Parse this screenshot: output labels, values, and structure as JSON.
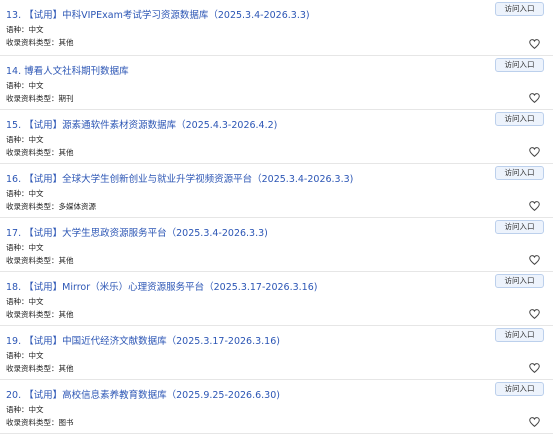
{
  "list": {
    "items": [
      {
        "title": "13. 【试用】中科VIPExam考试学习资源数据库（2025.3.4-2026.3.3)",
        "lang_label": "语种：中文",
        "type_label": "收录资料类型：其他",
        "button": "访问入口"
      },
      {
        "title": "14. 博看人文社科期刊数据库",
        "lang_label": "语种：中文",
        "type_label": "收录资料类型：期刊",
        "button": "访问入口"
      },
      {
        "title": "15. 【试用】源素通软件素材资源数据库（2025.4.3-2026.4.2)",
        "lang_label": "语种：中文",
        "type_label": "收录资料类型：其他",
        "button": "访问入口"
      },
      {
        "title": "16. 【试用】全球大学生创新创业与就业升学视频资源平台（2025.3.4-2026.3.3)",
        "lang_label": "语种：中文",
        "type_label": "收录资料类型：多媒体资源",
        "button": "访问入口"
      },
      {
        "title": "17. 【试用】大学生思政资源服务平台（2025.3.4-2026.3.3)",
        "lang_label": "语种：中文",
        "type_label": "收录资料类型：其他",
        "button": "访问入口"
      },
      {
        "title": "18. 【试用】Mirror（米乐）心理资源服务平台（2025.3.17-2026.3.16)",
        "lang_label": "语种：中文",
        "type_label": "收录资料类型：其他",
        "button": "访问入口"
      },
      {
        "title": "19. 【试用】中国近代经济文献数据库（2025.3.17-2026.3.16)",
        "lang_label": "语种：中文",
        "type_label": "收录资料类型：其他",
        "button": "访问入口"
      },
      {
        "title": "20. 【试用】高校信息素养教育数据库（2025.9.25-2026.6.30)",
        "lang_label": "语种：中文",
        "type_label": "收录资料类型：图书",
        "button": "访问入口"
      }
    ]
  },
  "colors": {
    "title_link": "#2c56b5",
    "button_bg": "#edf3fc",
    "button_border": "#bcd0ec",
    "divider": "#e6e6e6"
  },
  "icons": {
    "favorite": "heart-outline-icon"
  }
}
